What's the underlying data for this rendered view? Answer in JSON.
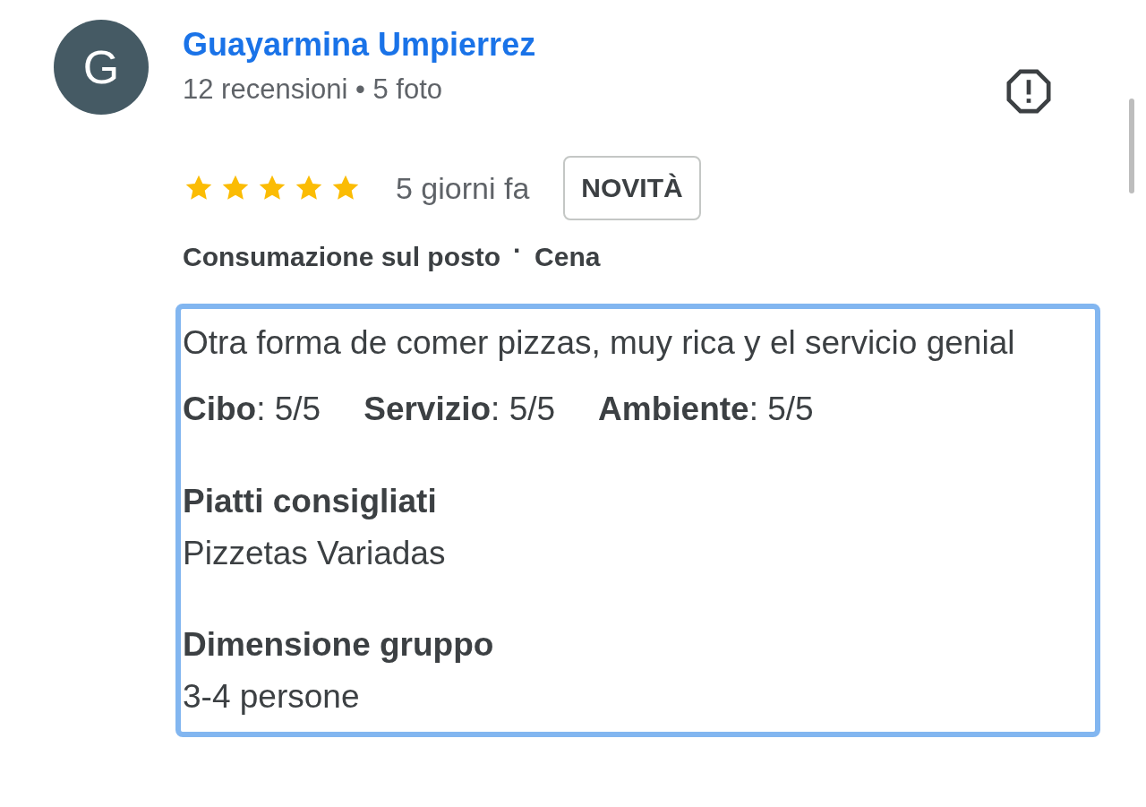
{
  "reviewer": {
    "initial": "G",
    "name": "Guayarmina Umpierrez",
    "stats": "12 recensioni • 5 foto"
  },
  "rating": {
    "stars": 5,
    "time": "5 giorni fa",
    "badge": "NOVITÀ"
  },
  "tags": [
    "Consumazione sul posto",
    "Cena"
  ],
  "tag_separator": "·",
  "review": {
    "text": "Otra forma de comer pizzas, muy rica y el servicio genial",
    "scores": [
      {
        "label": "Cibo",
        "value": ": 5/5"
      },
      {
        "label": "Servizio",
        "value": ": 5/5"
      },
      {
        "label": "Ambiente",
        "value": ": 5/5"
      }
    ],
    "sections": [
      {
        "heading": "Piatti consigliati",
        "value": "Pizzetas Variadas"
      },
      {
        "heading": "Dimensione gruppo",
        "value": "3-4 persone"
      }
    ]
  }
}
